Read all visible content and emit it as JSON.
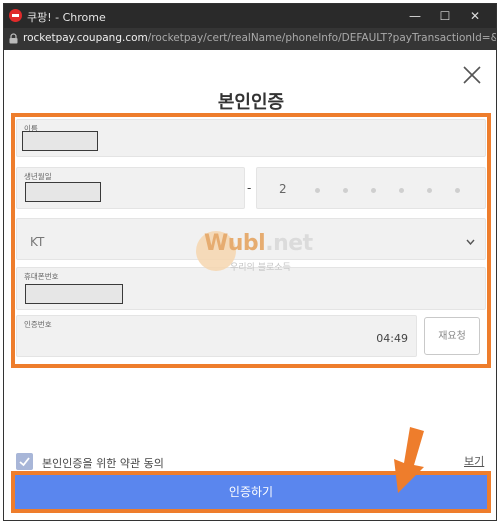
{
  "window": {
    "title": "쿠팡! - Chrome",
    "controls": {
      "minimize": "—",
      "maximize": "☐",
      "close": "✕"
    }
  },
  "address_bar": {
    "host": "rocketpay.coupang.com",
    "path": "/rocketpay/cert/realName/phoneInfo/DEFAULT?payTransactionId=&succ..."
  },
  "page": {
    "title": "본인인증",
    "fields": {
      "name": {
        "label": "이름"
      },
      "birth": {
        "label": "생년월일"
      },
      "rrn": {
        "dash": "-",
        "first_digit": "2"
      },
      "carrier": {
        "value": "KT"
      },
      "phone": {
        "label": "휴대폰번호"
      },
      "auth_code": {
        "label": "인증번호",
        "timer": "04:49"
      }
    },
    "resend_label": "재요청",
    "agreement": {
      "label": "본인인증을 위한 약관 동의",
      "view_link": "보기",
      "checked": true
    },
    "submit_label": "인증하기"
  },
  "watermark": {
    "logo_main": "Wubl",
    "logo_suffix": ".net",
    "subtitle": "우리의 블로소득"
  },
  "colors": {
    "highlight": "#ee7d2c",
    "button": "#5a86ee",
    "checkbox": "#a8b6d8"
  }
}
